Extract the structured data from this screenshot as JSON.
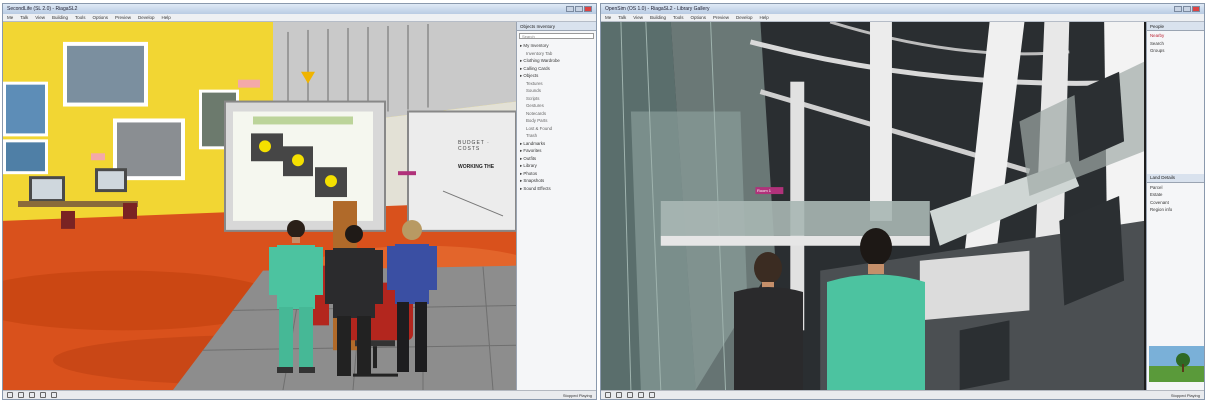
{
  "left_window": {
    "title": "SecondLife (SL 2.0) - RiagaSL2",
    "menu": [
      "Me",
      "Talk",
      "View",
      "Building",
      "Tools",
      "Options",
      "Preview",
      "Develop",
      "Help"
    ],
    "presentation": {
      "board1_header": "",
      "board2_lines": [
        "BUDGET · COSTS",
        "WORKING THE"
      ]
    },
    "sidebar": {
      "title": "Objects Inventory",
      "search_placeholder": "Search",
      "items": [
        {
          "label": "My Inventory",
          "sub": false
        },
        {
          "label": "Inventory Tab",
          "sub": true
        },
        {
          "label": "Clothing Wardrobe",
          "sub": false
        },
        {
          "label": "Calling Cards",
          "sub": false
        },
        {
          "label": "Objects",
          "sub": false
        },
        {
          "label": "Textures",
          "sub": true
        },
        {
          "label": "Sounds",
          "sub": true
        },
        {
          "label": "Scripts",
          "sub": true
        },
        {
          "label": "Gestures",
          "sub": true
        },
        {
          "label": "Notecards",
          "sub": true
        },
        {
          "label": "Body Parts",
          "sub": true
        },
        {
          "label": "Lost & Found",
          "sub": true
        },
        {
          "label": "Trash",
          "sub": true
        },
        {
          "label": "Landmarks",
          "sub": false
        },
        {
          "label": "Favorites",
          "sub": false
        },
        {
          "label": "Outfits",
          "sub": false
        },
        {
          "label": "Library",
          "sub": false
        },
        {
          "label": "Photos",
          "sub": false
        },
        {
          "label": "Snapshots",
          "sub": false
        },
        {
          "label": "Sound Effects",
          "sub": false
        }
      ]
    },
    "status": "Stopped  Playing"
  },
  "right_window": {
    "title": "OpenSim (OS 1.0) - RiagaSL2 - Library Gallery",
    "menu": [
      "Me",
      "Talk",
      "View",
      "Building",
      "Tools",
      "Options",
      "Preview",
      "Develop",
      "Help"
    ],
    "sign_label": "Room 1",
    "sidebar": {
      "title": "People",
      "top_items": [
        "Nearby",
        "Search",
        "Groups"
      ],
      "section2_title": "Land Details",
      "section2_items": [
        "Parcel",
        "Estate",
        "Covenant",
        "Region info"
      ]
    },
    "status": "Stopped  Playing"
  },
  "colors": {
    "left_wall": "#f2d633",
    "floor": "#d9511c",
    "right_sky": "#2a2e31",
    "panel": "#f5f6f8",
    "scrubs": "#4cc3a0"
  }
}
